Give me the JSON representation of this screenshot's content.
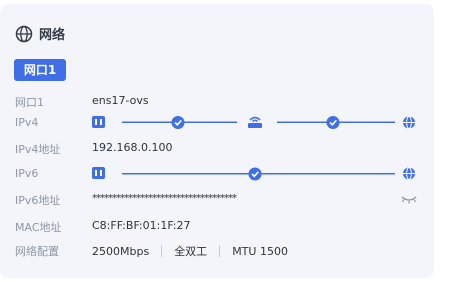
{
  "section": {
    "title": "网络",
    "icon": "globe-icon"
  },
  "tab": {
    "label": "网口1"
  },
  "rows": {
    "port": {
      "label": "网口1",
      "value": "ens17-ovs"
    },
    "ipv4": {
      "label": "IPv4"
    },
    "ipv4addr": {
      "label": "IPv4地址",
      "value": "192.168.0.100"
    },
    "ipv6": {
      "label": "IPv6"
    },
    "ipv6addr": {
      "label": "IPv6地址",
      "value": "************************************"
    },
    "mac": {
      "label": "MAC地址",
      "value": "C8:FF:BF:01:1F:27"
    },
    "config": {
      "label": "网络配置",
      "speed": "2500Mbps",
      "duplex": "全双工",
      "mtu": "MTU 1500"
    }
  },
  "colors": {
    "accent": "#3f6ee7",
    "muted": "#8f96a3",
    "text": "#2d333c",
    "card": "#f3f5fa"
  },
  "icons": [
    "globe-icon",
    "network-card-icon",
    "router-icon",
    "check-circle-icon",
    "eye-closed-icon"
  ]
}
